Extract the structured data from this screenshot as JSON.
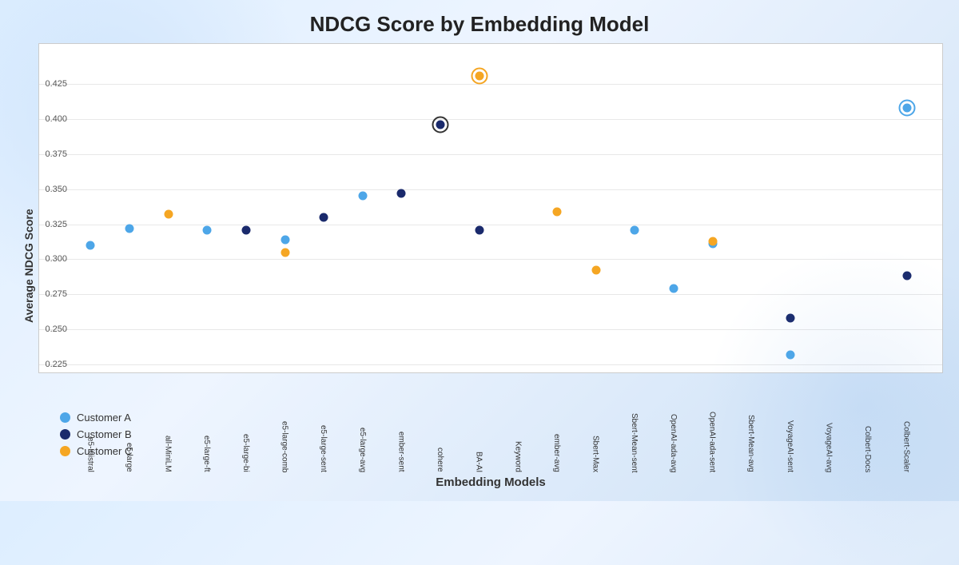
{
  "title": "NDCG Score by Embedding Model",
  "yAxisLabel": "Average NDCG Score",
  "xAxisLabel": "Embedding Models",
  "yTicks": [
    {
      "label": "0.425",
      "pct": 100
    },
    {
      "label": "0.400",
      "pct": 83.3
    },
    {
      "label": "0.375",
      "pct": 66.7
    },
    {
      "label": "0.350",
      "pct": 50
    },
    {
      "label": "0.325",
      "pct": 33.3
    },
    {
      "label": "0.300",
      "pct": 16.7
    },
    {
      "label": "0.275",
      "pct": 0
    }
  ],
  "yMin": 0.225,
  "yMax": 0.445,
  "models": [
    "e5-mistral",
    "e5-large",
    "all-MiniLM",
    "e5-large-ft",
    "e5-large-bi",
    "e5-large-comb",
    "e5-large-sent",
    "e5-large-avg",
    "ember-sent",
    "cohere",
    "BA-AI",
    "Keyword",
    "ember-avg",
    "Sbert-Max",
    "Sbert-Mean-sent",
    "OpenAI-ada-avg",
    "OpenAI-ada-sent",
    "Sbert-Mean-avg",
    "VoyageAI-sent",
    "VoyageAI-avg",
    "Colbert-Docs",
    "Colbert-Scaler"
  ],
  "series": {
    "customerA": {
      "label": "Customer A",
      "color": "#4da6e8",
      "values": [
        0.31,
        0.322,
        null,
        0.321,
        null,
        0.314,
        null,
        0.345,
        null,
        null,
        null,
        null,
        null,
        null,
        0.321,
        0.279,
        0.311,
        null,
        0.232,
        null,
        null,
        0.408
      ]
    },
    "customerB": {
      "label": "Customer B",
      "color": "#1a2a6c",
      "values": [
        null,
        null,
        null,
        null,
        0.321,
        null,
        0.33,
        null,
        0.347,
        0.396,
        0.321,
        null,
        null,
        null,
        null,
        null,
        null,
        null,
        0.258,
        null,
        null,
        0.288
      ]
    },
    "customerC": {
      "label": "Customer C",
      "color": "#f5a623",
      "values": [
        null,
        null,
        0.332,
        null,
        null,
        0.305,
        null,
        null,
        null,
        null,
        0.431,
        null,
        0.334,
        0.292,
        null,
        null,
        0.313,
        null,
        null,
        null,
        null,
        null
      ]
    }
  },
  "highlighted": [
    {
      "model": "cohere",
      "series": "customerB",
      "color": "dark"
    },
    {
      "model": "BA-AI",
      "series": "customerC",
      "color": "orange"
    },
    {
      "model": "Colbert-Scaler",
      "series": "customerA",
      "color": "blue"
    }
  ],
  "legend": [
    {
      "label": "Customer A",
      "color": "#4da6e8"
    },
    {
      "label": "Customer B",
      "color": "#1a2a6c"
    },
    {
      "label": "Customer C",
      "color": "#f5a623"
    }
  ]
}
